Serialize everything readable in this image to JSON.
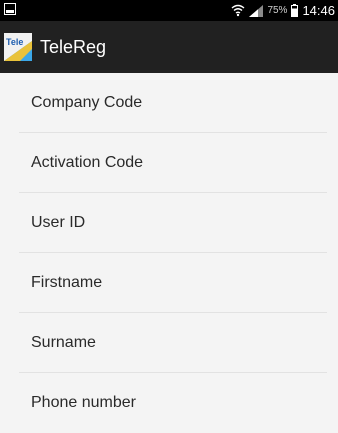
{
  "status_bar": {
    "battery_percent": "75%",
    "time": "14:46",
    "icons": [
      "screenshot-icon",
      "wifi-icon",
      "signal-icon",
      "battery-icon"
    ]
  },
  "app_bar": {
    "logo_text": "Tele",
    "title": "TeleReg"
  },
  "form": {
    "fields": [
      {
        "placeholder": "Company Code",
        "value": ""
      },
      {
        "placeholder": "Activation Code",
        "value": ""
      },
      {
        "placeholder": "User ID",
        "value": ""
      },
      {
        "placeholder": "Firstname",
        "value": ""
      },
      {
        "placeholder": "Surname",
        "value": ""
      },
      {
        "placeholder": "Phone number",
        "value": ""
      }
    ]
  },
  "colors": {
    "status_bar": "#000000",
    "app_bar": "#212121",
    "background": "#f4f4f4",
    "divider": "#e2e2e2"
  }
}
